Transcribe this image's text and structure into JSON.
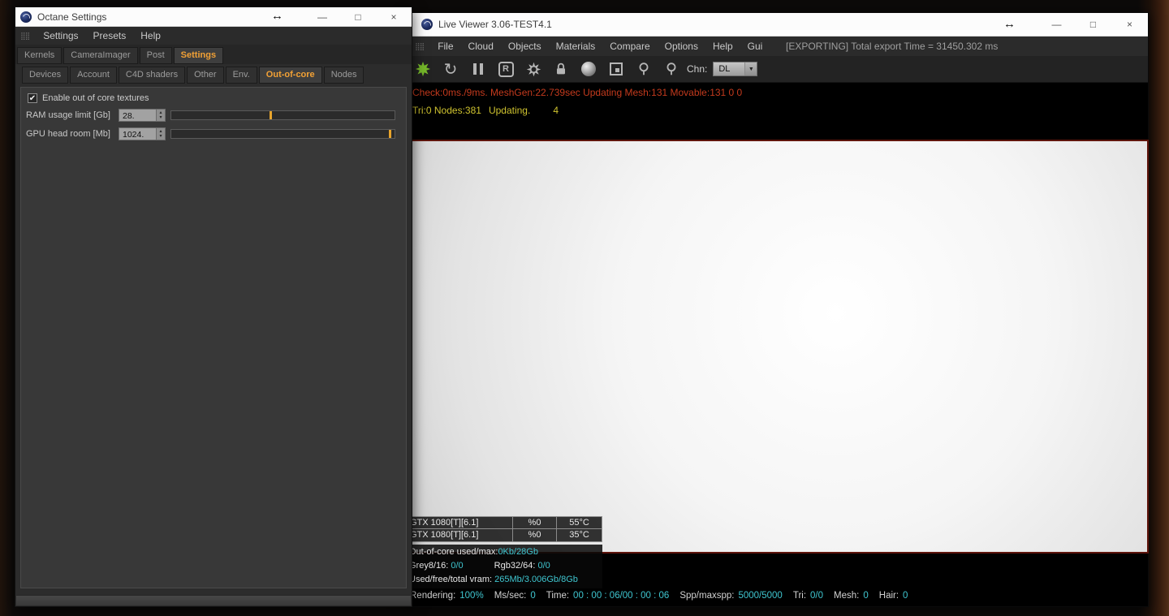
{
  "colors": {
    "accent_orange": "#f2a135",
    "status_red": "#c43a1d",
    "status_yellow": "#cfc32f",
    "value_cyan": "#3fc6d0",
    "octane_green": "#76b82a"
  },
  "octane_settings": {
    "title": "Octane Settings",
    "cursor_glyph": "↔",
    "controls": {
      "minimize": "—",
      "maximize": "□",
      "close": "×"
    },
    "grip_icon": "⣿⣿",
    "menu": [
      "Settings",
      "Presets",
      "Help"
    ],
    "tabs": [
      "Kernels",
      "CameraImager",
      "Post",
      "Settings"
    ],
    "selected_tab": "Settings",
    "subtabs": [
      "Devices",
      "Account",
      "C4D shaders",
      "Other",
      "Env.",
      "Out-of-core",
      "Nodes"
    ],
    "selected_subtab": "Out-of-core",
    "out_of_core": {
      "checkbox_label": "Enable out of core textures",
      "checkbox_checked": true,
      "check_glyph": "✔",
      "spinner_up": "▴",
      "spinner_down": "▾",
      "ram": {
        "label": "RAM usage limit [Gb]",
        "value": "28.",
        "marker_pct": 44,
        "fill_pct": 0
      },
      "gpu": {
        "label": "GPU head room [Mb]",
        "value": "1024.",
        "marker_pct": 97.5,
        "fill_pct": 97
      }
    }
  },
  "live_viewer": {
    "title": "Live Viewer 3.06-TEST4.1",
    "cursor_glyph": "↔",
    "controls": {
      "minimize": "—",
      "maximize": "□",
      "close": "×"
    },
    "grip_icon": "⣿⣿",
    "menu": [
      "File",
      "Cloud",
      "Objects",
      "Materials",
      "Compare",
      "Options",
      "Help",
      "Gui"
    ],
    "export_status": "[EXPORTING] Total export Time = 31450.302 ms",
    "toolbar": {
      "refresh_glyph": "↻",
      "restart_label": "R",
      "channel_label": "Chn:",
      "channel_value": "DL",
      "dropdown_arrow": "▼"
    },
    "status_line1": "Check:0ms./9ms. MeshGen:22.739sec Updating Mesh:131 Movable:131  0 0",
    "status_line2": {
      "counts": "Tri:0 Nodes:381",
      "state": "Updating.",
      "extra": "4"
    },
    "gpu_panel": {
      "rows": [
        {
          "name": "GTX 1080[T][6.1]",
          "load": "%0",
          "temp": "55°C"
        },
        {
          "name": "GTX 1080[T][6.1]",
          "load": "%0",
          "temp": "35°C"
        }
      ],
      "out_of_core_label": "Out-of-core used/max:",
      "out_of_core_value": "0Kb/28Gb",
      "grey_label": "Grey8/16:",
      "grey_value": "0/0",
      "rgb_label": "Rgb32/64:",
      "rgb_value": "0/0",
      "vram_label": "Used/free/total vram:",
      "vram_value": "265Mb/3.006Gb/8Gb"
    },
    "footer": [
      {
        "label": "Rendering:",
        "value": "100%"
      },
      {
        "label": "Ms/sec:",
        "value": "0"
      },
      {
        "label": "Time:",
        "value": "00 : 00 : 06/00 : 00 : 06"
      },
      {
        "label": "Spp/maxspp:",
        "value": "5000/5000"
      },
      {
        "label": "Tri:",
        "value": "0/0"
      },
      {
        "label": "Mesh:",
        "value": "0"
      },
      {
        "label": "Hair:",
        "value": "0"
      }
    ]
  }
}
